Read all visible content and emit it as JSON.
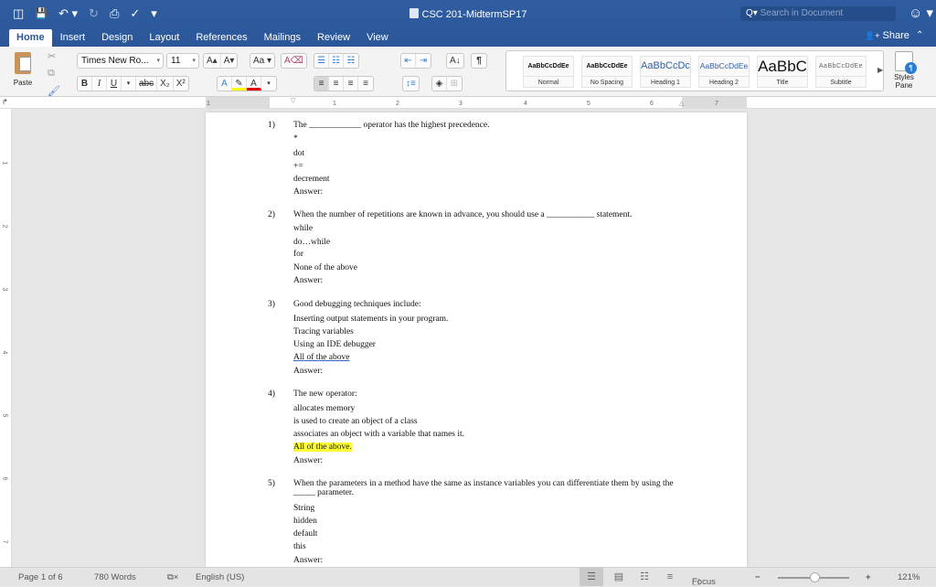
{
  "window": {
    "title": "CSC 201-MidtermSP17"
  },
  "qat": {
    "sidebar": "◫",
    "save": "💾",
    "undo": "↶ ▾",
    "redo": "↻",
    "print": "⎙",
    "spelling": "✓",
    "customize": "▾"
  },
  "search": {
    "placeholder": "Search in Document",
    "icon": "Q▾"
  },
  "account": {
    "icon": "☺ ▾"
  },
  "tabs": [
    "Home",
    "Insert",
    "Design",
    "Layout",
    "References",
    "Mailings",
    "Review",
    "View"
  ],
  "share": {
    "label": "Share",
    "icon": "👤+"
  },
  "ribbon": {
    "paste_label": "Paste",
    "font_name": "Times New Ro...",
    "font_size": "11",
    "grow": "A▴",
    "shrink": "A▾",
    "change_case": "Aa ▾",
    "clear_format": "A⌫",
    "bold": "B",
    "italic": "I",
    "underline": "U",
    "strike": "abc",
    "subscript": "X₂",
    "superscript": "X²",
    "text_effects": "A",
    "highlight": "✎",
    "font_color": "A",
    "bullets": "☰",
    "numbering": "☷",
    "multilevel": "☵",
    "outdent": "⇤",
    "indent": "⇥",
    "sort": "A↓",
    "pilcrow": "¶",
    "align_left": "≡",
    "align_center": "≡",
    "align_right": "≡",
    "justify": "≡",
    "line_spacing": "↕≡",
    "shading": "◈",
    "borders": "⊞",
    "styles": [
      {
        "preview": "AaBbCcDdEe",
        "label": "Normal"
      },
      {
        "preview": "AaBbCcDdEe",
        "label": "No Spacing"
      },
      {
        "preview": "AaBbCcDc",
        "label": "Heading 1"
      },
      {
        "preview": "AaBbCcDdEe",
        "label": "Heading 2"
      },
      {
        "preview": "AaBbC",
        "label": "Title"
      },
      {
        "preview": "AaBbCcDdEe",
        "label": "Subtitle"
      }
    ],
    "styles_pane": "Styles Pane"
  },
  "ruler": {
    "h": [
      "1",
      "1",
      "2",
      "3",
      "4",
      "5",
      "6",
      "7"
    ],
    "v": [
      "1",
      "2",
      "3",
      "4",
      "5",
      "6",
      "7"
    ]
  },
  "document": {
    "questions": [
      {
        "num": "1)",
        "text": "The ____________ operator has the highest precedence.",
        "options": [
          "*",
          "dot",
          "+=",
          "decrement",
          "Answer:"
        ]
      },
      {
        "num": "2)",
        "text": "When the number of repetitions are known in advance, you should use a ___________ statement.",
        "options": [
          "while",
          "do…while",
          "for",
          "None of the above",
          "Answer:"
        ]
      },
      {
        "num": "3)",
        "text": "Good debugging techniques include:",
        "options": [
          "Inserting output statements in your program.",
          "Tracing variables",
          "Using an IDE debugger",
          "All of the above",
          "Answer:"
        ]
      },
      {
        "num": "4)",
        "text": "The new operator:",
        "options": [
          "allocates memory",
          "is used to create an object of a class",
          "associates an object with a variable that names it.",
          "All of the above.",
          "Answer:"
        ]
      },
      {
        "num": "5)",
        "text": "When the parameters in a method have the same as instance variables you can differentiate them by using the _____ parameter.",
        "options": [
          "String",
          "hidden",
          "default",
          "this",
          "Answer:"
        ]
      }
    ]
  },
  "status": {
    "page": "Page 1 of 6",
    "words": "780 Words",
    "proofing_icon": "⧉×",
    "language": "English (US)",
    "focus": "Focus",
    "zoom_minus": "−",
    "zoom_plus": "+",
    "zoom": "121%",
    "zoom_level_percent": 121
  }
}
